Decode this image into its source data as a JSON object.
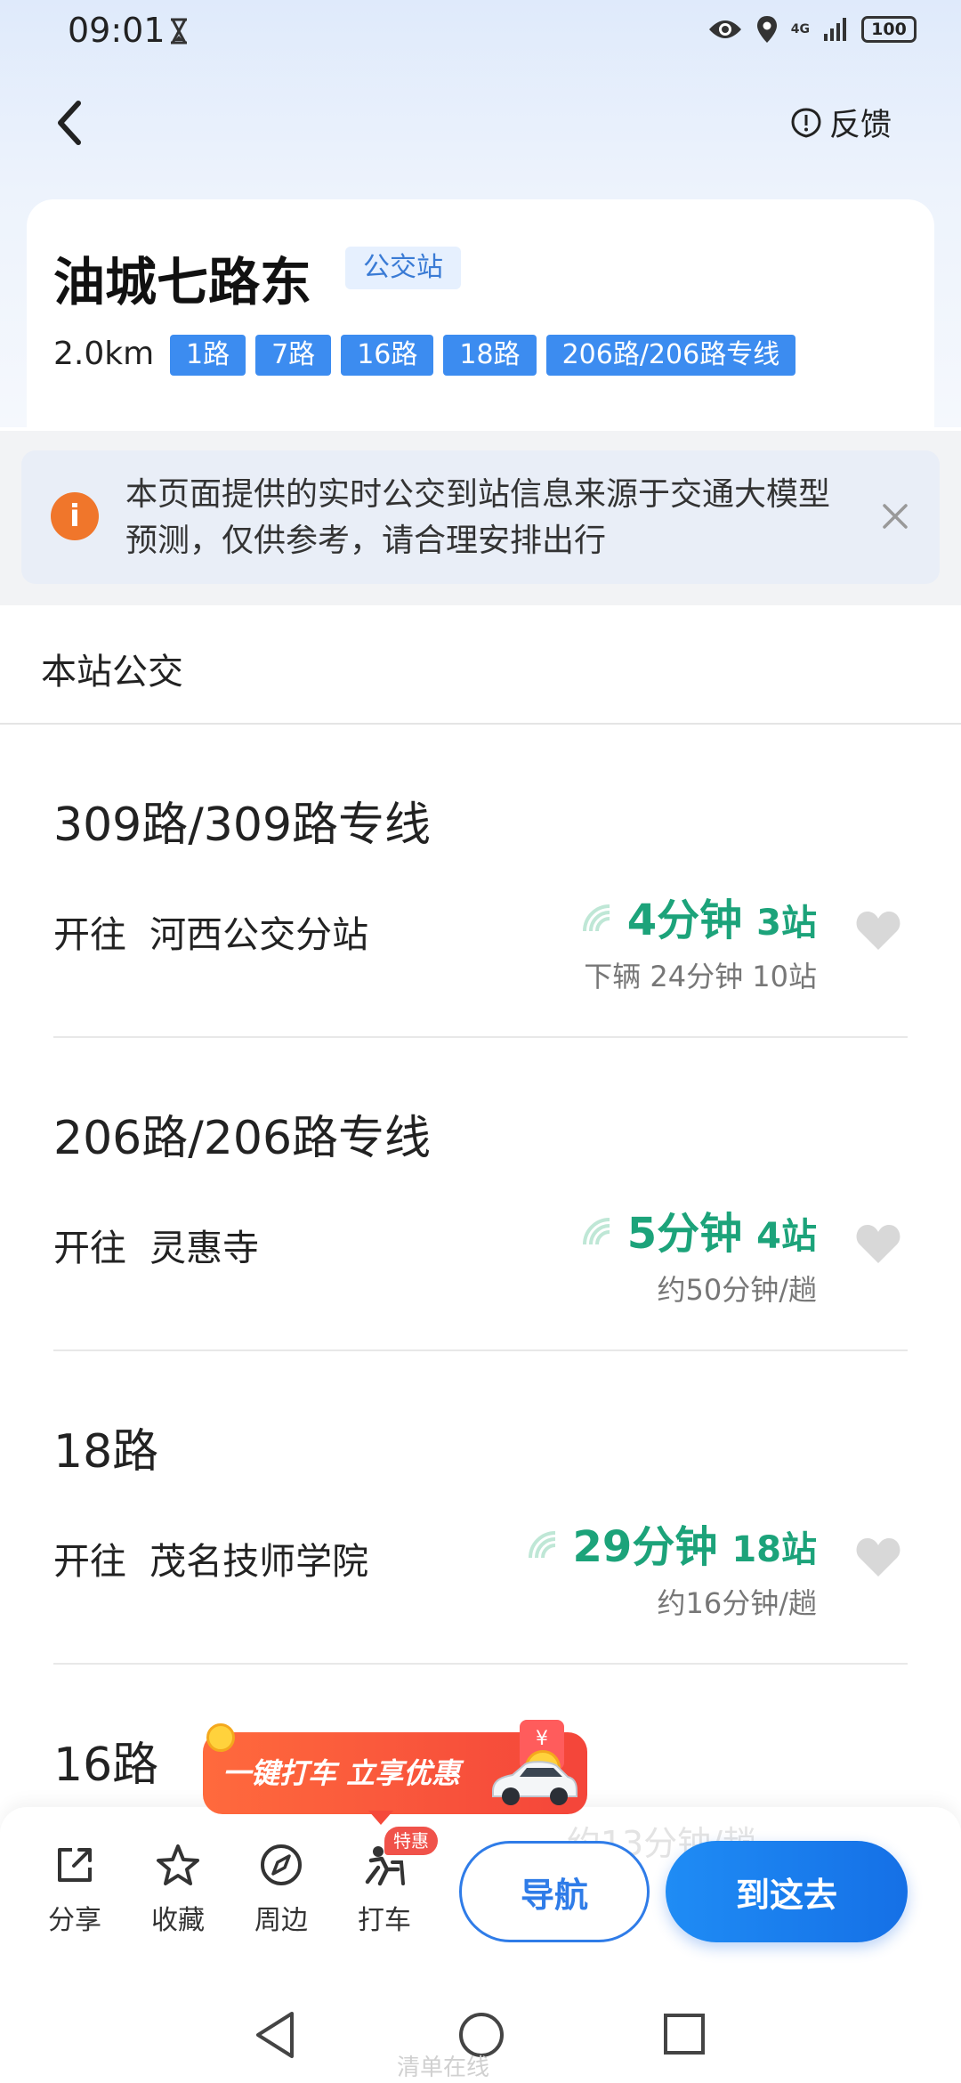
{
  "status_bar": {
    "time": "09:01",
    "network": "4G",
    "battery": "100"
  },
  "header": {
    "feedback_label": "反馈"
  },
  "stop": {
    "name": "油城七路东",
    "type_badge": "公交站",
    "distance": "2.0km",
    "routes": [
      "1路",
      "7路",
      "16路",
      "18路",
      "206路/206路专线"
    ]
  },
  "notice": {
    "icon": "i",
    "text": "本页面提供的实时公交到站信息来源于交通大模型预测，仅供参考，请合理安排出行"
  },
  "section": {
    "title": "本站公交"
  },
  "bus_lines": [
    {
      "name": "309路/309路专线",
      "direction": "开往  河西公交分站",
      "eta": "4分钟",
      "stops": "3站",
      "sub": "下辆 24分钟 10站"
    },
    {
      "name": "206路/206路专线",
      "direction": "开往  灵惠寺",
      "eta": "5分钟",
      "stops": "4站",
      "sub": "约50分钟/趟"
    },
    {
      "name": "18路",
      "direction": "开往  茂名技师学院",
      "eta": "29分钟",
      "stops": "18站",
      "sub": "约16分钟/趟"
    },
    {
      "name": "16路"
    }
  ],
  "ghost": "约13分钟/趟",
  "promo": {
    "banner": "一键打车 立享优惠",
    "gift_symbol": "¥",
    "badge": "特惠"
  },
  "toolbar": {
    "share_label": "分享",
    "favorite_label": "收藏",
    "nearby_label": "周边",
    "taxi_label": "打车",
    "navigate_label": "导航",
    "go_label": "到这去"
  },
  "watermark": "清单在线",
  "colors": {
    "route_tag": "#3c8cf0",
    "eta_green": "#1ca37a",
    "primary_blue": "#1570e6",
    "notice_icon": "#f0762b",
    "promo_red": "#f4453a"
  }
}
